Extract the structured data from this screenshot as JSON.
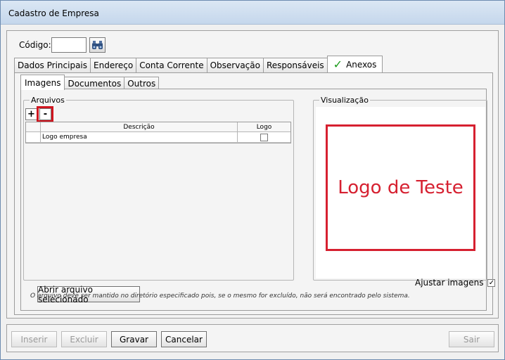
{
  "window": {
    "title": "Cadastro de Empresa"
  },
  "codigo": {
    "label": "Código:",
    "value": ""
  },
  "main_tabs": [
    {
      "label": "Dados Principais"
    },
    {
      "label": "Endereço"
    },
    {
      "label": "Conta Corrente"
    },
    {
      "label": "Observação"
    },
    {
      "label": "Responsáveis"
    },
    {
      "label": "Anexos",
      "active": true
    }
  ],
  "sub_tabs": [
    {
      "label": "Imagens",
      "active": true
    },
    {
      "label": "Documentos"
    },
    {
      "label": "Outros"
    }
  ],
  "arquivos": {
    "legend": "Arquivos",
    "add_label": "+",
    "remove_label": "-",
    "columns": {
      "descricao": "Descrição",
      "logo": "Logo"
    },
    "rows": [
      {
        "descricao": "Logo empresa",
        "logo": false
      }
    ]
  },
  "visualizacao": {
    "legend": "Visualização",
    "preview_text": "Logo de Teste"
  },
  "abrir_button": "Abrir arquivo selecionado",
  "ajustar": {
    "label": "Ajustar imagens",
    "checked": true,
    "check_mark": "✓"
  },
  "note": "O arquivo deve ser mantido no diretório especificado pois, se o mesmo for excluído, não será encontrado pelo sistema.",
  "footer": {
    "inserir": "Inserir",
    "excluir": "Excluir",
    "gravar": "Gravar",
    "cancelar": "Cancelar",
    "sair": "Sair"
  },
  "colors": {
    "accent_red": "#d62030",
    "check_green": "#1a9a1a"
  }
}
